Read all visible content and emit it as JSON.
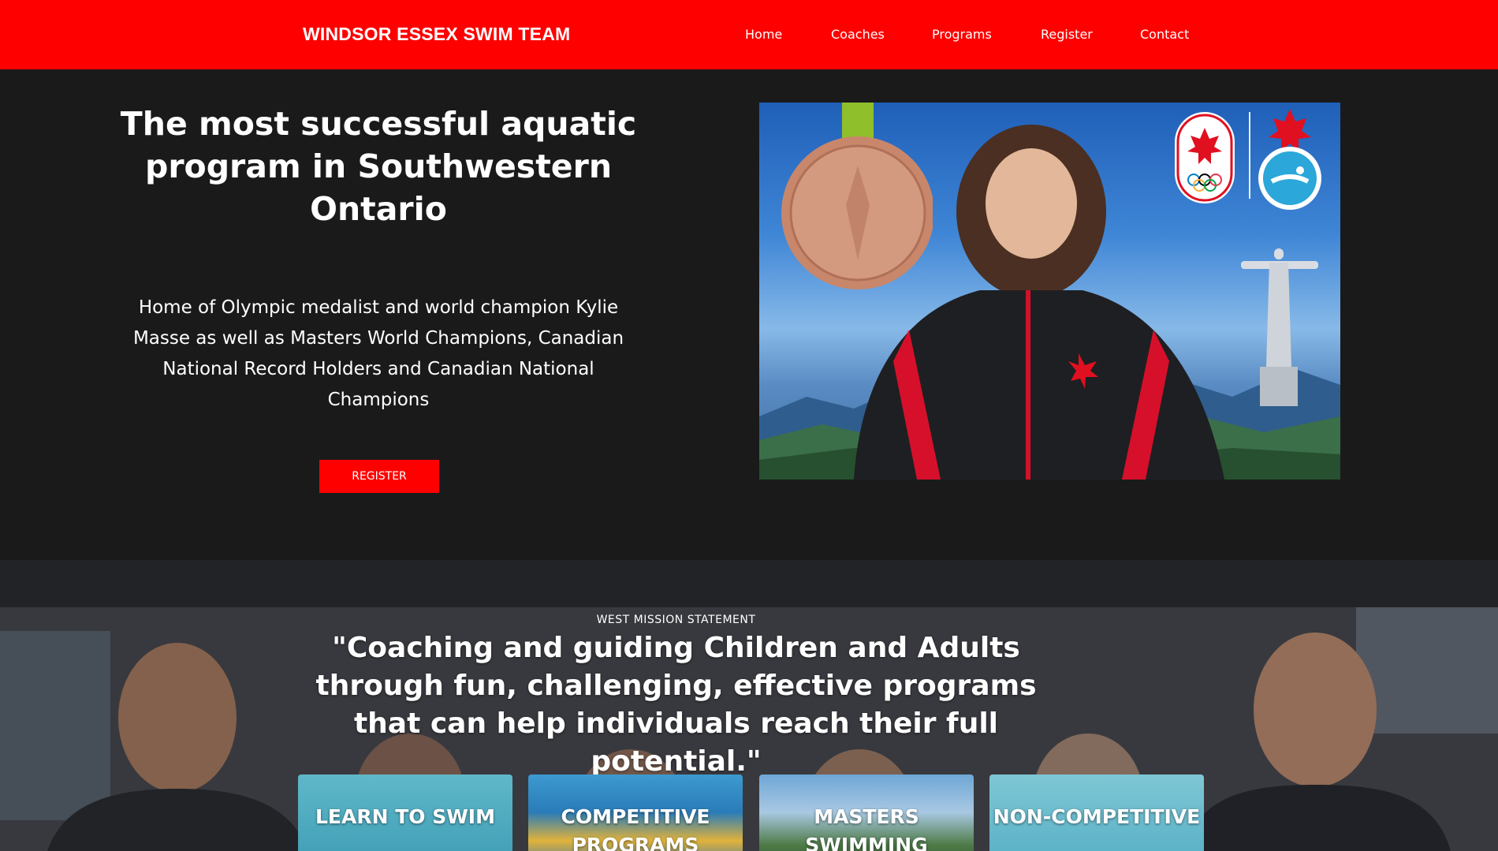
{
  "header": {
    "brand": "WINDSOR ESSEX SWIM TEAM",
    "nav": [
      "Home",
      "Coaches",
      "Programs",
      "Register",
      "Contact"
    ]
  },
  "hero": {
    "title": "The most successful aquatic program in Southwestern Ontario",
    "text": "Home of Olympic medalist and world champion Kylie Masse as well as Masters World Champions, Canadian National Record Holders and Canadian National Champions",
    "register_label": "REGISTER"
  },
  "mission": {
    "label": "WEST MISSION STATEMENT",
    "quote": "\"Coaching and guiding Children and Adults through fun, challenging, effective programs that can help individuals reach their full potential.\""
  },
  "programs": [
    "LEARN TO SWIM",
    "COMPETITIVE PROGRAMS",
    "MASTERS SWIMMING",
    "NON-COMPETITIVE"
  ],
  "colors": {
    "brand_red": "#ff0000",
    "dark_bg": "#1a1a1b"
  }
}
